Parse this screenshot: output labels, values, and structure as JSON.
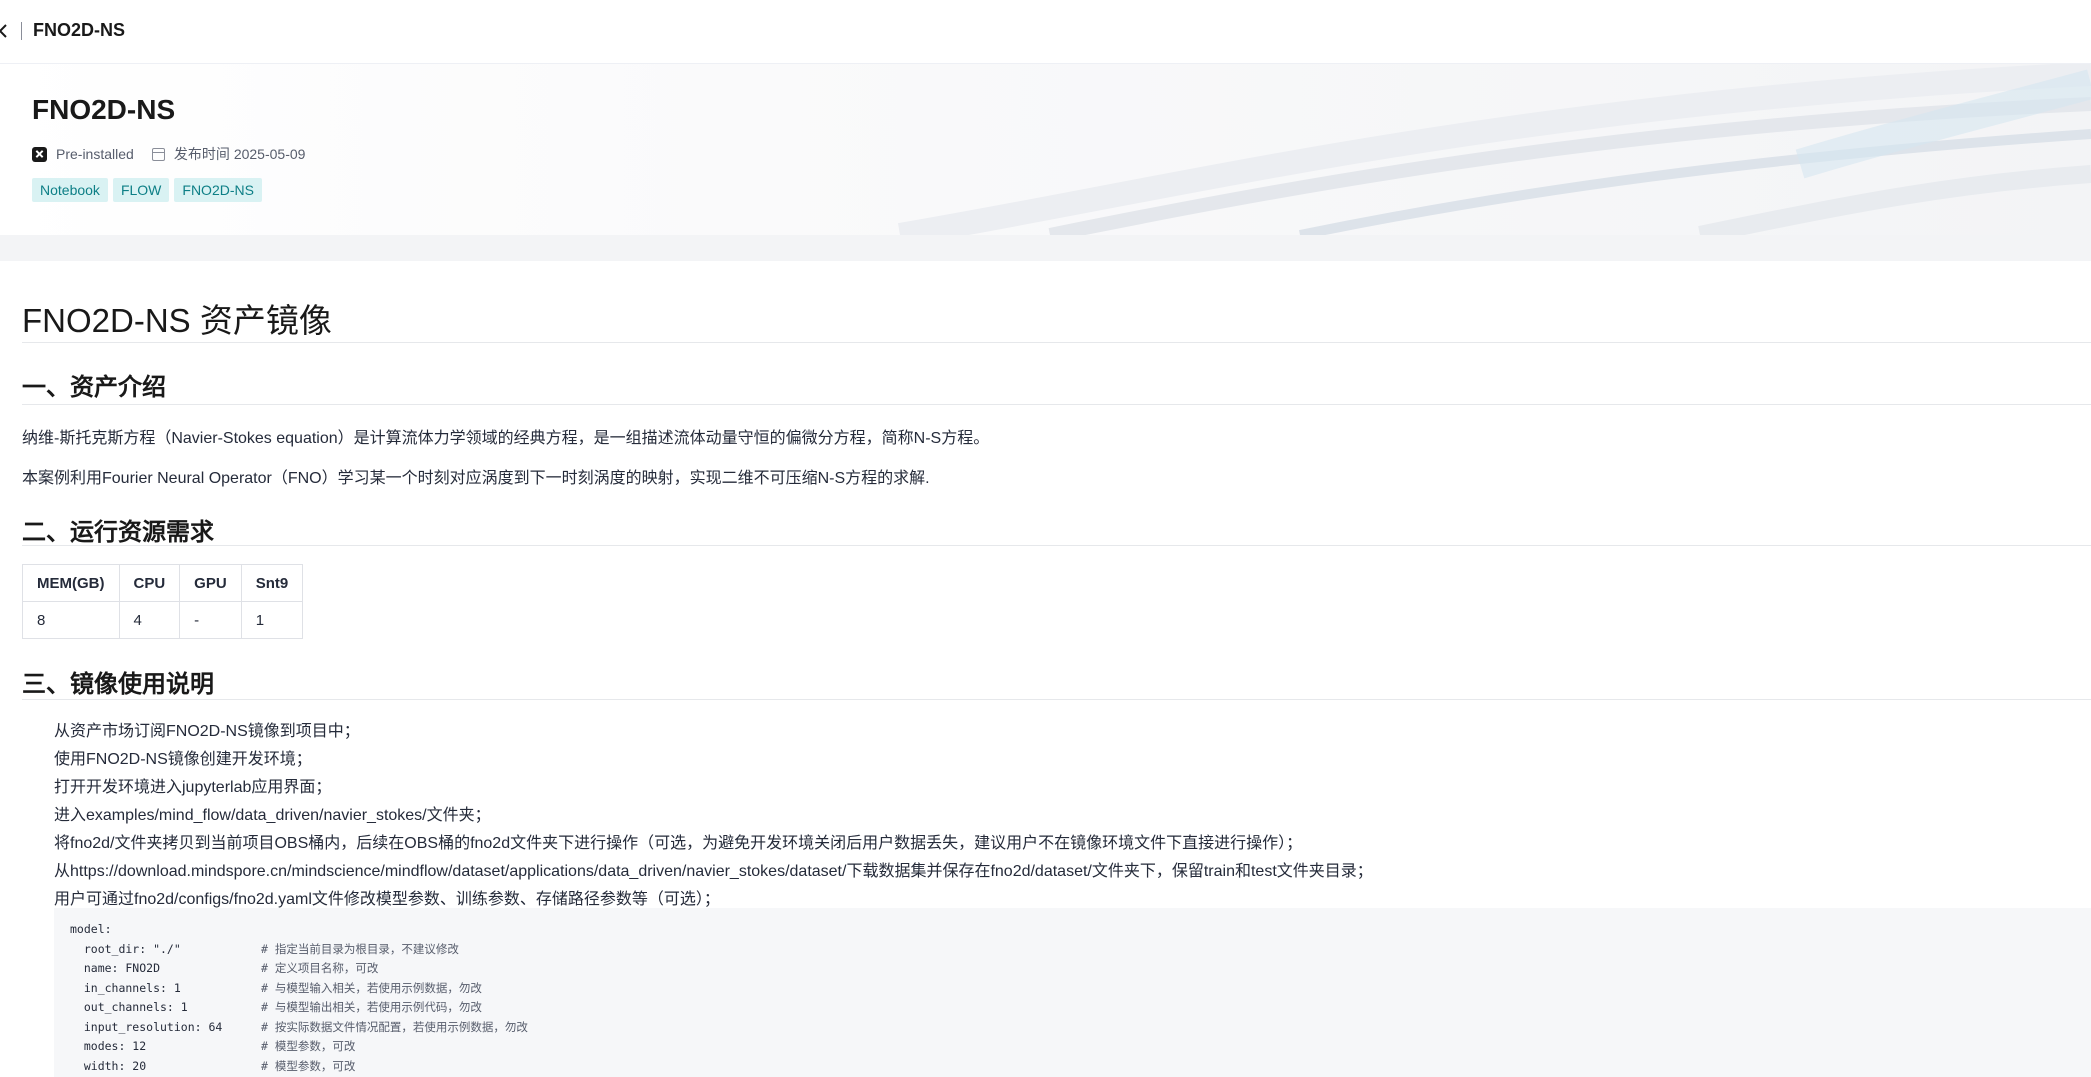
{
  "header": {
    "title": "FNO2D-NS"
  },
  "hero": {
    "title": "FNO2D-NS",
    "preinstalled_label": "Pre-installed",
    "publish_label": "发布时间",
    "publish_date": "2025-05-09",
    "tags": [
      "Notebook",
      "FLOW",
      "FNO2D-NS"
    ]
  },
  "doc": {
    "title": "FNO2D-NS 资产镜像",
    "section1": {
      "heading": "一、资产介绍",
      "paragraphs": [
        "纳维-斯托克斯方程（Navier-Stokes equation）是计算流体力学领域的经典方程，是一组描述流体动量守恒的偏微分方程，简称N-S方程。",
        "本案例利用Fourier Neural Operator（FNO）学习某一个时刻对应涡度到下一时刻涡度的映射，实现二维不可压缩N-S方程的求解."
      ]
    },
    "section2": {
      "heading": "二、运行资源需求",
      "table": {
        "headers": [
          "MEM(GB)",
          "CPU",
          "GPU",
          "Snt9"
        ],
        "rows": [
          [
            "8",
            "4",
            "-",
            "1"
          ]
        ]
      }
    },
    "section3": {
      "heading": "三、镜像使用说明",
      "steps": [
        "从资产市场订阅FNO2D-NS镜像到项目中；",
        "使用FNO2D-NS镜像创建开发环境；",
        "打开开发环境进入jupyterlab应用界面；",
        "进入examples/mind_flow/data_driven/navier_stokes/文件夹；",
        "将fno2d/文件夹拷贝到当前项目OBS桶内，后续在OBS桶的fno2d文件夹下进行操作（可选，为避免开发环境关闭后用户数据丢失，建议用户不在镜像环境文件下直接进行操作）；",
        "从https://download.mindspore.cn/mindscience/mindflow/dataset/applications/data_driven/navier_stokes/dataset/下载数据集并保存在fno2d/dataset/文件夹下，保留train和test文件夹目录；",
        "用户可通过fno2d/configs/fno2d.yaml文件修改模型参数、训练参数、存储路径参数等（可选）；"
      ],
      "code": [
        {
          "key": "model:",
          "comment": ""
        },
        {
          "key": "  root_dir: \"./\"",
          "comment": "# 指定当前目录为根目录，不建议修改"
        },
        {
          "key": "  name: FNO2D",
          "comment": "# 定义项目名称，可改"
        },
        {
          "key": "  in_channels: 1",
          "comment": "# 与模型输入相关，若使用示例数据，勿改"
        },
        {
          "key": "  out_channels: 1",
          "comment": "# 与模型输出相关，若使用示例代码，勿改"
        },
        {
          "key": "  input_resolution: 64",
          "comment": "# 按实际数据文件情况配置，若使用示例数据，勿改"
        },
        {
          "key": "  modes: 12",
          "comment": "# 模型参数，可改"
        },
        {
          "key": "  width: 20",
          "comment": "# 模型参数，可改"
        }
      ]
    }
  }
}
